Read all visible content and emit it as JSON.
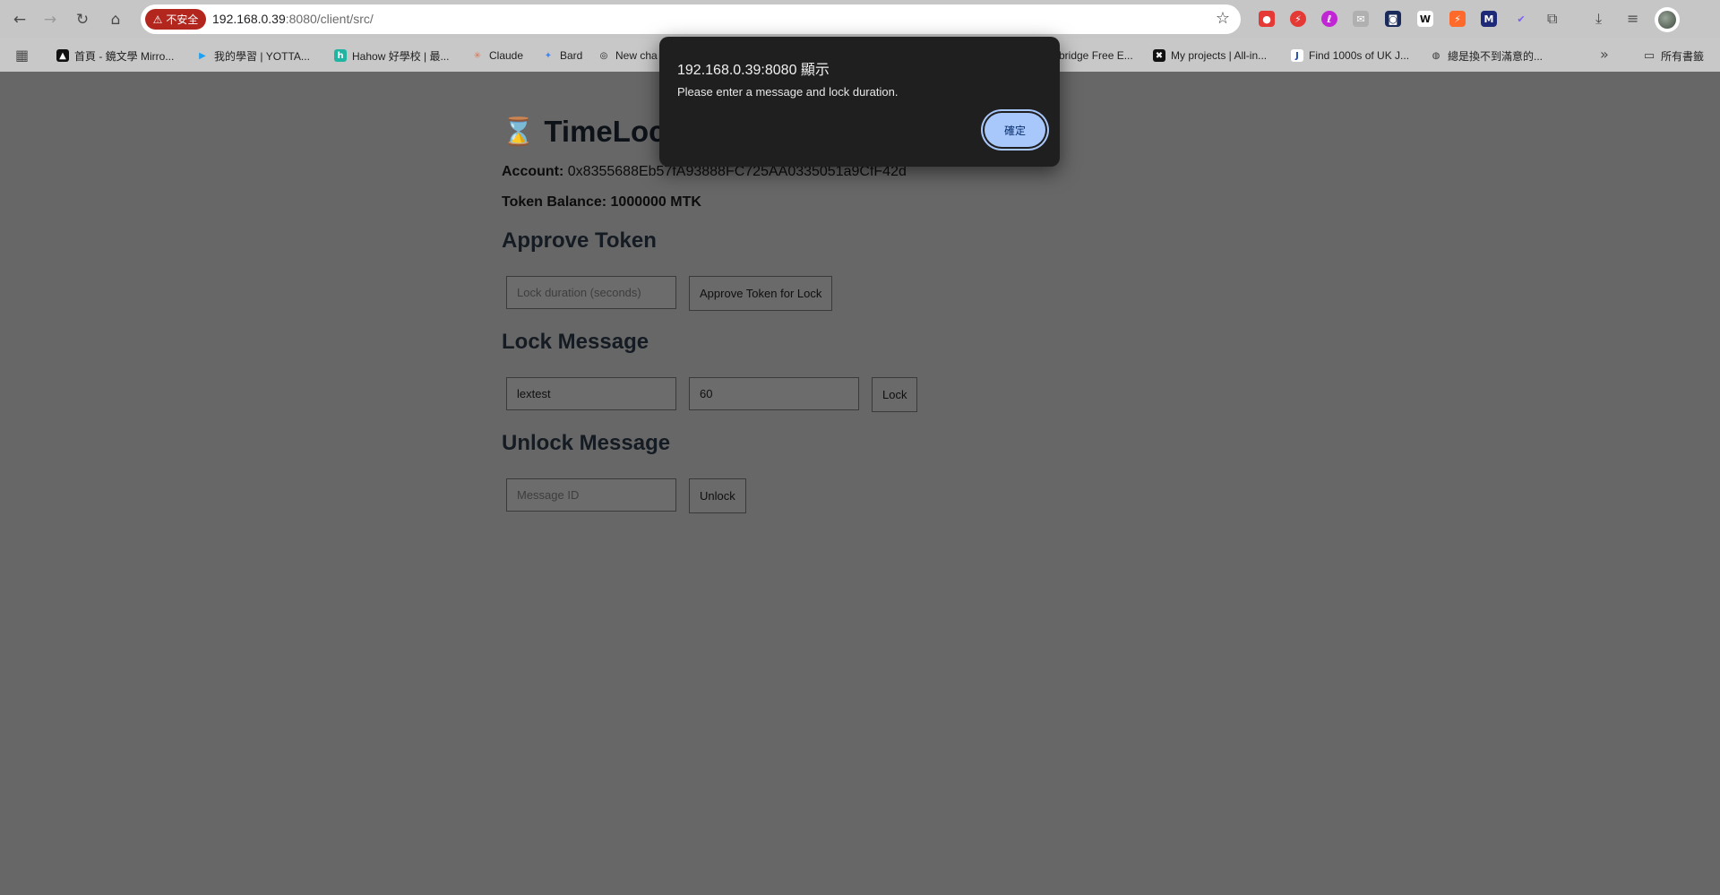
{
  "browser": {
    "security_label": "不安全",
    "url_host": "192.168.0.39",
    "url_rest": ":8080/client/src/",
    "bookmarks": [
      {
        "label": "首頁 - 鏡文學 Mirro...",
        "icon_color": "#111111"
      },
      {
        "label": "我的學習 | YOTTA...",
        "icon_color": "#1da1f2"
      },
      {
        "label": "Hahow 好學校 | 最...",
        "icon_color": "#1fb5a2"
      },
      {
        "label": "Claude",
        "icon_color": "#d97757"
      },
      {
        "label": "Bard",
        "icon_color": "#4285f4"
      },
      {
        "label": "New cha",
        "icon_color": "#202020"
      },
      {
        "label": "bridge Free E...",
        "icon_color": "#9a9a9a"
      },
      {
        "label": "My projects | All-in...",
        "icon_color": "#111111"
      },
      {
        "label": "Find 1000s of UK J...",
        "icon_color": "#1f4aa8"
      },
      {
        "label": "總是換不到滿意的...",
        "icon_color": "#333333"
      }
    ],
    "all_bookmarks_label": "所有書籤"
  },
  "app": {
    "title": "TimeLoc",
    "account_label": "Account:",
    "account_value": "0x8355688Eb57fA93888FC725AA0335051a9CfF42d",
    "balance_text": "Token Balance: 1000000 MTK",
    "approve": {
      "heading": "Approve Token",
      "duration_placeholder": "Lock duration (seconds)",
      "button": "Approve Token for Lock"
    },
    "lock": {
      "heading": "Lock Message",
      "message_value": "lextest",
      "duration_value": "60",
      "button": "Lock"
    },
    "unlock": {
      "heading": "Unlock Message",
      "id_placeholder": "Message ID",
      "button": "Unlock"
    }
  },
  "dialog": {
    "title": "192.168.0.39:8080 顯示",
    "message": "Please enter a message and lock duration.",
    "ok_label": "確定"
  },
  "colors": {
    "insecure": "#b3261e",
    "dialog_bg": "#1f1f1f",
    "ok_button": "#a8c7fa"
  }
}
